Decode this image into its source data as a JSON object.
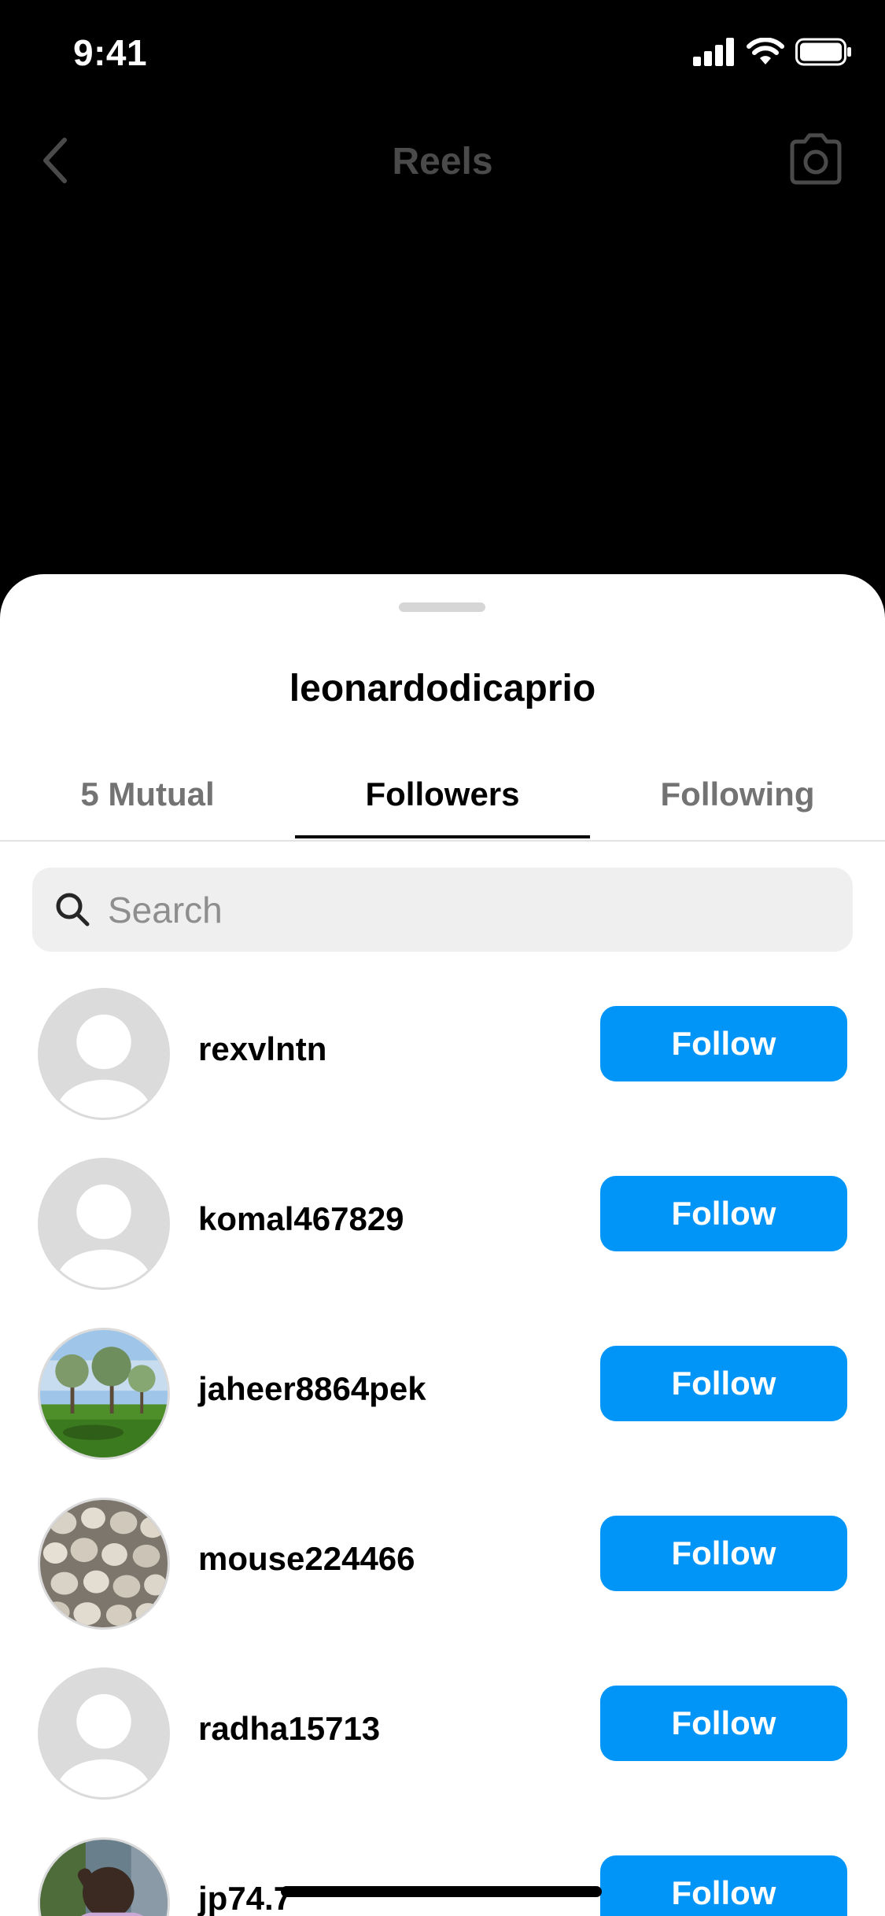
{
  "status_bar": {
    "time": "9:41"
  },
  "nav": {
    "title": "Reels"
  },
  "sheet": {
    "title": "leonardodicaprio"
  },
  "tabs": [
    {
      "label": "5 Mutual",
      "active": false
    },
    {
      "label": "Followers",
      "active": true
    },
    {
      "label": "Following",
      "active": false
    }
  ],
  "search": {
    "placeholder": "Search",
    "value": ""
  },
  "followers": [
    {
      "username": "rexvlntn",
      "avatar": "default",
      "button": "Follow"
    },
    {
      "username": "komal467829",
      "avatar": "default",
      "button": "Follow"
    },
    {
      "username": "jaheer8864pek",
      "avatar": "landscape-photo",
      "button": "Follow"
    },
    {
      "username": "mouse224466",
      "avatar": "pebbles-photo",
      "button": "Follow"
    },
    {
      "username": "radha15713",
      "avatar": "default",
      "button": "Follow"
    },
    {
      "username": "jp74.7",
      "avatar": "person-photo",
      "button": "Follow"
    }
  ],
  "colors": {
    "accent": "#0095f6",
    "sheet_bg": "#ffffff",
    "backdrop": "#000000"
  }
}
